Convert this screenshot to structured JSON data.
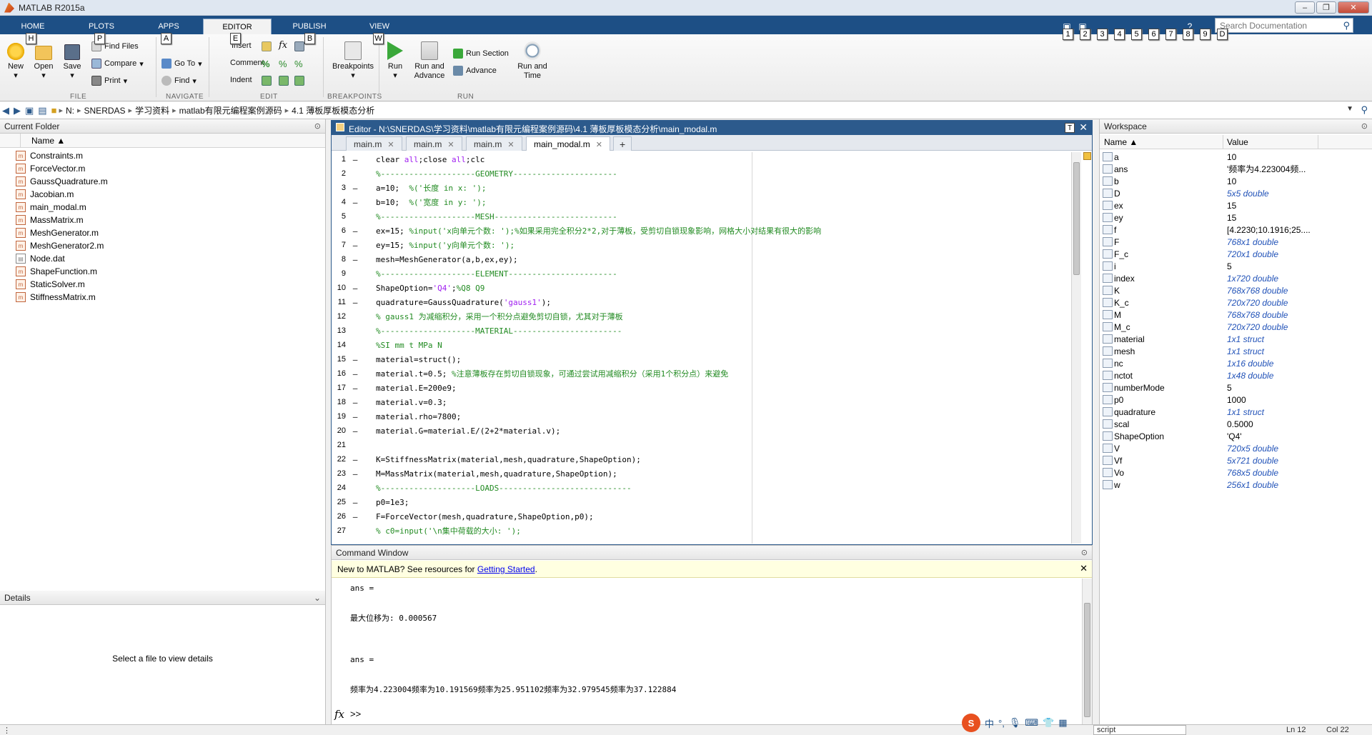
{
  "window": {
    "title": "MATLAB R2015a"
  },
  "tabs": [
    {
      "label": "HOME",
      "key": "H"
    },
    {
      "label": "PLOTS",
      "key": "P"
    },
    {
      "label": "APPS",
      "key": "A"
    },
    {
      "label": "EDITOR",
      "key": "E"
    },
    {
      "label": "PUBLISH",
      "key": "B"
    },
    {
      "label": "VIEW",
      "key": "W"
    }
  ],
  "quick_keys": [
    "1",
    "2",
    "3",
    "4",
    "5",
    "6",
    "7",
    "8",
    "9",
    "D"
  ],
  "search": {
    "placeholder": "Search Documentation"
  },
  "ribbon": {
    "file": {
      "group": "FILE",
      "new": "New",
      "open": "Open",
      "save": "Save",
      "find_files": "Find Files",
      "compare": "Compare",
      "print": "Print"
    },
    "navigate": {
      "group": "NAVIGATE",
      "go_to": "Go To",
      "find": "Find"
    },
    "edit": {
      "group": "EDIT",
      "insert": "Insert",
      "comment": "Comment",
      "indent": "Indent",
      "fx": "fx"
    },
    "breakpoints": {
      "group": "BREAKPOINTS",
      "breakpoints": "Breakpoints"
    },
    "run": {
      "group": "RUN",
      "run": "Run",
      "run_advance_1": "Run and",
      "run_advance_2": "Advance",
      "run_section": "Run Section",
      "advance": "Advance",
      "run_time_1": "Run and",
      "run_time_2": "Time"
    }
  },
  "path": [
    "N:",
    "SNERDAS",
    "学习资料",
    "matlab有限元编程案例源码",
    "4.1 薄板厚板模态分析"
  ],
  "current_folder": {
    "title": "Current Folder",
    "col_name": "Name ▲",
    "files": [
      "Constraints.m",
      "ForceVector.m",
      "GaussQuadrature.m",
      "Jacobian.m",
      "main_modal.m",
      "MassMatrix.m",
      "MeshGenerator.m",
      "MeshGenerator2.m",
      "Node.dat",
      "ShapeFunction.m",
      "StaticSolver.m",
      "StiffnessMatrix.m"
    ]
  },
  "details": {
    "title": "Details",
    "empty": "Select a file to view details"
  },
  "editor": {
    "title": "Editor - N:\\SNERDAS\\学习资料\\matlab有限元编程案例源码\\4.1 薄板厚板模态分析\\main_modal.m",
    "tabs": [
      "main.m",
      "main.m",
      "main.m",
      "main_modal.m"
    ],
    "add_tab": "+",
    "lines": [
      {
        "n": "1",
        "d": "—",
        "t": "clear all;close all;clc"
      },
      {
        "n": "2",
        "d": "",
        "t": "%--------------------GEOMETRY----------------------"
      },
      {
        "n": "3",
        "d": "—",
        "t": "a=10;  %('长度 in x: ');"
      },
      {
        "n": "4",
        "d": "—",
        "t": "b=10;  %('宽度 in y: ');"
      },
      {
        "n": "5",
        "d": "",
        "t": "%--------------------MESH--------------------------"
      },
      {
        "n": "6",
        "d": "—",
        "t": "ex=15; %input('x向单元个数: ');%如果采用完全积分2*2,对于薄板，受剪切自锁现象影响，网格大小对结果有很大的影响"
      },
      {
        "n": "7",
        "d": "—",
        "t": "ey=15; %input('y向单元个数: ');"
      },
      {
        "n": "8",
        "d": "—",
        "t": "mesh=MeshGenerator(a,b,ex,ey);"
      },
      {
        "n": "9",
        "d": "",
        "t": "%--------------------ELEMENT-----------------------"
      },
      {
        "n": "10",
        "d": "—",
        "t": "ShapeOption='Q4';%Q8 Q9"
      },
      {
        "n": "11",
        "d": "—",
        "t": "quadrature=GaussQuadrature('gauss1');"
      },
      {
        "n": "12",
        "d": "",
        "t": "% gauss1 为减缩积分，采用一个积分点避免剪切自锁，尤其对于薄板"
      },
      {
        "n": "13",
        "d": "",
        "t": "%--------------------MATERIAL-----------------------"
      },
      {
        "n": "14",
        "d": "",
        "t": "%SI mm t MPa N"
      },
      {
        "n": "15",
        "d": "—",
        "t": "material=struct();"
      },
      {
        "n": "16",
        "d": "—",
        "t": "material.t=0.5; %注意薄板存在剪切自锁现象，可通过尝试用减缩积分（采用1个积分点）来避免"
      },
      {
        "n": "17",
        "d": "—",
        "t": "material.E=200e9;"
      },
      {
        "n": "18",
        "d": "—",
        "t": "material.v=0.3;"
      },
      {
        "n": "19",
        "d": "—",
        "t": "material.rho=7800;"
      },
      {
        "n": "20",
        "d": "—",
        "t": "material.G=material.E/(2+2*material.v);"
      },
      {
        "n": "21",
        "d": "",
        "t": ""
      },
      {
        "n": "22",
        "d": "—",
        "t": "K=StiffnessMatrix(material,mesh,quadrature,ShapeOption);"
      },
      {
        "n": "23",
        "d": "—",
        "t": "M=MassMatrix(material,mesh,quadrature,ShapeOption);"
      },
      {
        "n": "24",
        "d": "",
        "t": "%--------------------LOADS----------------------------"
      },
      {
        "n": "25",
        "d": "—",
        "t": "p0=1e3;"
      },
      {
        "n": "26",
        "d": "—",
        "t": "F=ForceVector(mesh,quadrature,ShapeOption,p0);"
      },
      {
        "n": "27",
        "d": "",
        "t": "% c0=input('\\n集中荷载的大小: ');"
      }
    ]
  },
  "command_window": {
    "title": "Command Window",
    "notice_text": "New to MATLAB? See resources for ",
    "notice_link": "Getting Started",
    "notice_end": ".",
    "output": [
      "ans =",
      "最大位移为: 0.000567",
      "ans =",
      "频率为4.223004频率为10.191569频率为25.951102频率为32.979545频率为37.122884"
    ],
    "prompt": ">>"
  },
  "workspace": {
    "title": "Workspace",
    "col_name": "Name ▲",
    "col_value": "Value",
    "vars": [
      {
        "name": "a",
        "value": "10",
        "it": false
      },
      {
        "name": "ans",
        "value": "'频率为4.223004频...",
        "it": false
      },
      {
        "name": "b",
        "value": "10",
        "it": false
      },
      {
        "name": "D",
        "value": "5x5 double",
        "it": true
      },
      {
        "name": "ex",
        "value": "15",
        "it": false
      },
      {
        "name": "ey",
        "value": "15",
        "it": false
      },
      {
        "name": "f",
        "value": "[4.2230;10.1916;25....",
        "it": false
      },
      {
        "name": "F",
        "value": "768x1 double",
        "it": true
      },
      {
        "name": "F_c",
        "value": "720x1 double",
        "it": true
      },
      {
        "name": "i",
        "value": "5",
        "it": false
      },
      {
        "name": "index",
        "value": "1x720 double",
        "it": true
      },
      {
        "name": "K",
        "value": "768x768 double",
        "it": true
      },
      {
        "name": "K_c",
        "value": "720x720 double",
        "it": true
      },
      {
        "name": "M",
        "value": "768x768 double",
        "it": true
      },
      {
        "name": "M_c",
        "value": "720x720 double",
        "it": true
      },
      {
        "name": "material",
        "value": "1x1 struct",
        "it": true
      },
      {
        "name": "mesh",
        "value": "1x1 struct",
        "it": true
      },
      {
        "name": "nc",
        "value": "1x16 double",
        "it": true
      },
      {
        "name": "nctot",
        "value": "1x48 double",
        "it": true
      },
      {
        "name": "numberMode",
        "value": "5",
        "it": false
      },
      {
        "name": "p0",
        "value": "1000",
        "it": false
      },
      {
        "name": "quadrature",
        "value": "1x1 struct",
        "it": true
      },
      {
        "name": "scal",
        "value": "0.5000",
        "it": false
      },
      {
        "name": "ShapeOption",
        "value": "'Q4'",
        "it": false
      },
      {
        "name": "V",
        "value": "720x5 double",
        "it": true
      },
      {
        "name": "Vf",
        "value": "5x721 double",
        "it": true
      },
      {
        "name": "Vo",
        "value": "768x5 double",
        "it": true
      },
      {
        "name": "w",
        "value": "256x1 double",
        "it": true
      }
    ]
  },
  "status": {
    "left": "",
    "right": "script",
    "ln": "Ln  12",
    "col": "Col  22"
  },
  "ime": {
    "zh": "中",
    "punct": "°,"
  }
}
